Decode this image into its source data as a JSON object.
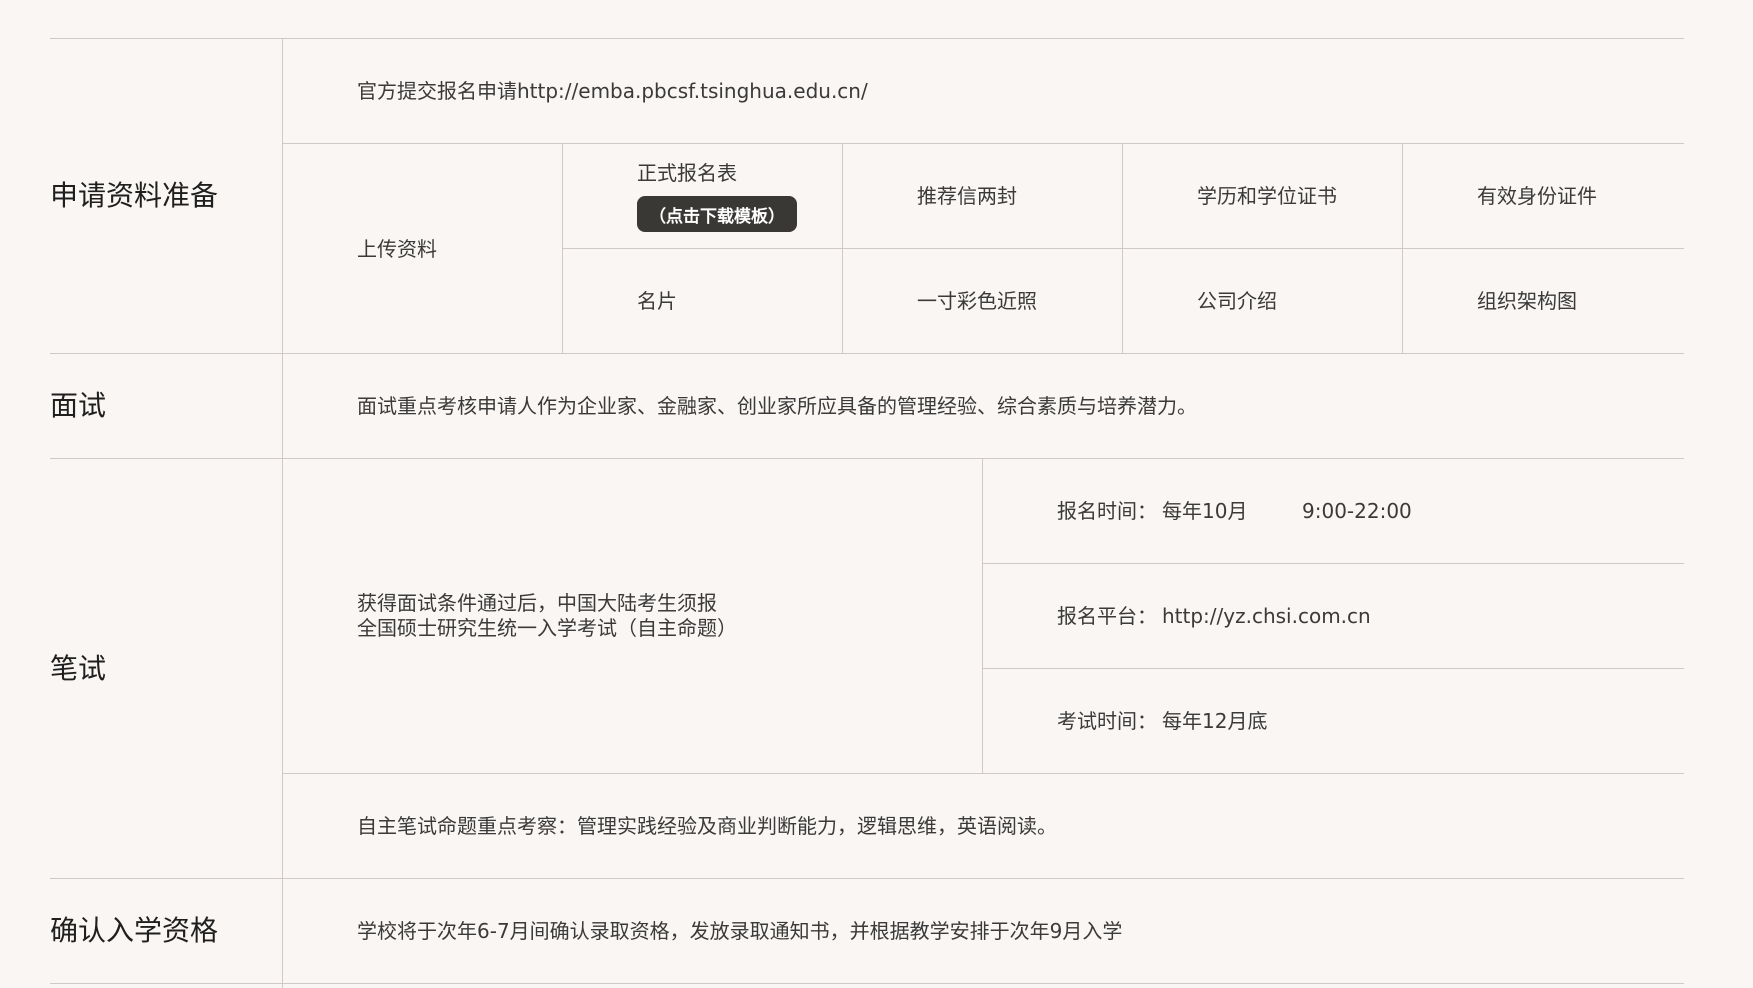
{
  "sections": {
    "apply": {
      "title": "申请资料准备",
      "submit_text": "官方提交报名申请http://emba.pbcsf.tsinghua.edu.cn/",
      "upload_label": "上传资料",
      "form_label": "正式报名表",
      "download_button": "（点击下载模板）",
      "docs": [
        "推荐信两封",
        "学历和学位证书",
        "有效身份证件",
        "名片",
        "一寸彩色近照",
        "公司介绍",
        "组织架构图"
      ]
    },
    "interview": {
      "title": "面试",
      "text": "面试重点考核申请人作为企业家、金融家、创业家所应具备的管理经验、综合素质与培养潜力。"
    },
    "written": {
      "title": "笔试",
      "desc_line1": "获得面试条件通过后，中国大陆考生须报",
      "desc_line2": "全国硕士研究生统一入学考试（自主命题）",
      "reg_time_label": "报名时间：",
      "reg_time_value": "每年10月",
      "reg_time_hours": "9:00-22:00",
      "platform_label": "报名平台：",
      "platform_value": "http://yz.chsi.com.cn",
      "exam_time_label": "考试时间：",
      "exam_time_value": "每年12月底",
      "focus_text": "自主笔试命题重点考察：管理实践经验及商业判断能力，逻辑思维，英语阅读。"
    },
    "confirm": {
      "title": "确认入学资格",
      "text": "学校将于次年6-7月间确认录取资格，发放录取通知书，并根据教学安排于次年9月入学"
    }
  }
}
